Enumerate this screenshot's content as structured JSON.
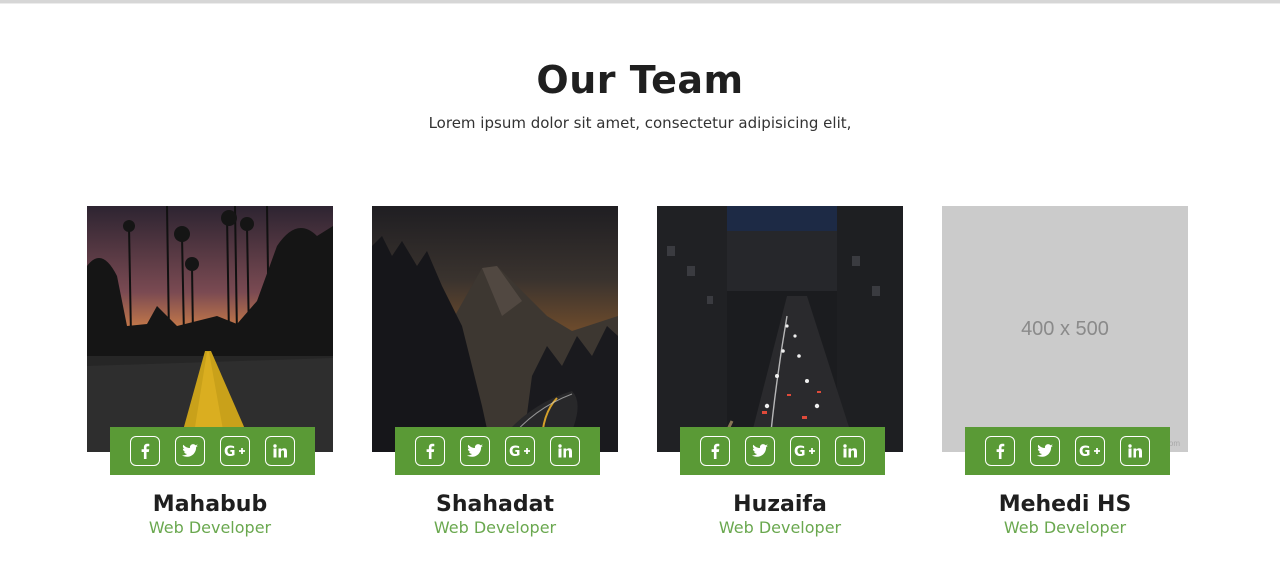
{
  "section": {
    "title": "Our Team",
    "subtitle": "Lorem ipsum dolor sit amet, consectetur adipisicing elit,"
  },
  "colors": {
    "accent": "#5a9a36",
    "role_text": "#6aa84f",
    "placeholder_bg": "#cbcbcb"
  },
  "social_icons": [
    "facebook-icon",
    "twitter-icon",
    "google-plus-icon",
    "linkedin-icon"
  ],
  "members": [
    {
      "name": "Mahabub",
      "role": "Web Developer",
      "photo": "sunset-road-with-palm-trees"
    },
    {
      "name": "Shahadat",
      "role": "Web Developer",
      "photo": "mountain-road-at-dusk"
    },
    {
      "name": "Huzaifa",
      "role": "Web Developer",
      "photo": "city-traffic-at-night"
    },
    {
      "name": "Mehedi HS",
      "role": "Web Developer",
      "photo": "placeholder",
      "placeholder_text": "400 x 500",
      "placeholder_small": "com"
    }
  ]
}
